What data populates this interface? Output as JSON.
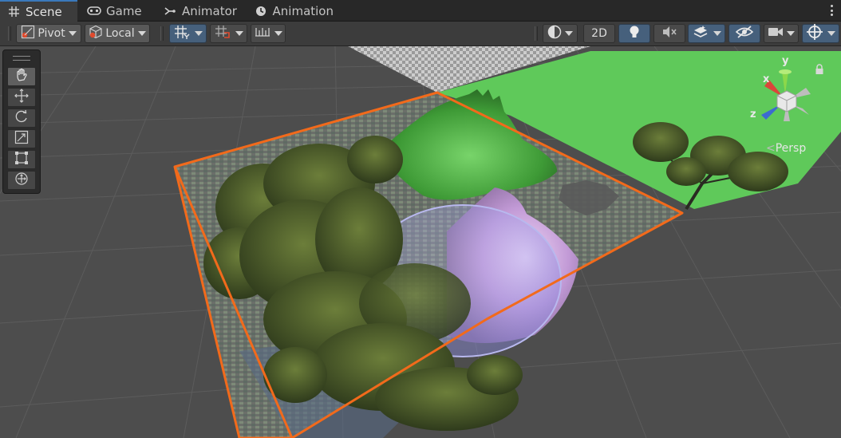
{
  "tabs": [
    {
      "label": "Scene",
      "icon": "grid-icon",
      "active": true
    },
    {
      "label": "Game",
      "icon": "gamepad-icon",
      "active": false
    },
    {
      "label": "Animator",
      "icon": "animator-icon",
      "active": false
    },
    {
      "label": "Animation",
      "icon": "clock-icon",
      "active": false
    }
  ],
  "toolbar": {
    "pivot_label": "Pivot",
    "local_label": "Local",
    "mode_2d_label": "2D"
  },
  "gizmo": {
    "x_label": "x",
    "y_label": "y",
    "z_label": "z",
    "projection_label": "Persp"
  },
  "colors": {
    "selection_outline": "#f26a1b",
    "grid_background": "#4d4d4d",
    "terrain_green": "#5fc95a",
    "active_toggle": "#46607c"
  }
}
